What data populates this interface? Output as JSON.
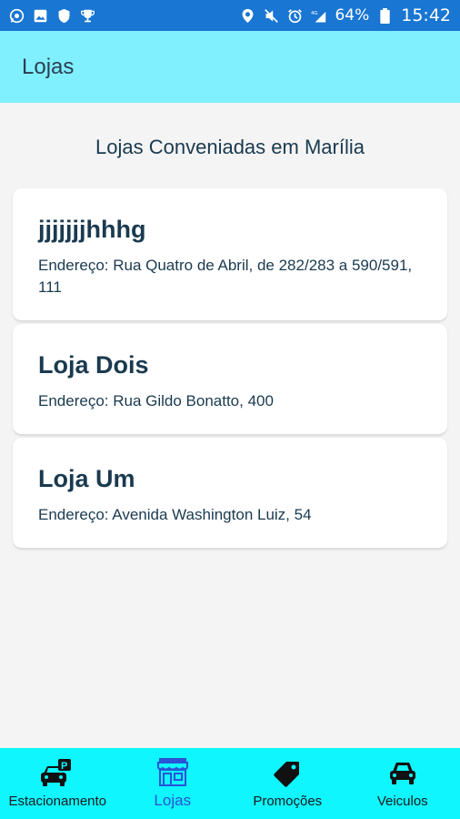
{
  "status_bar": {
    "battery": "64%",
    "time": "15:42",
    "network": "4G",
    "icons_left": [
      "whatsapp-icon",
      "image-icon",
      "shield-icon",
      "trophy-icon"
    ],
    "icons_right": [
      "location-icon",
      "mute-icon",
      "alarm-icon",
      "signal-icon",
      "battery-icon"
    ]
  },
  "app_bar": {
    "title": "Lojas"
  },
  "main": {
    "section_title": "Lojas Conveniadas em Marília",
    "stores": [
      {
        "name": "jjjjjjjhhhg",
        "address": "Endereço: Rua Quatro de Abril, de 282/283 a 590/591, 111"
      },
      {
        "name": "Loja Dois",
        "address": "Endereço: Rua Gildo Bonatto, 400"
      },
      {
        "name": "Loja Um",
        "address": "Endereço: Avenida Washington Luiz, 54"
      }
    ]
  },
  "bottom_nav": {
    "items": [
      {
        "label": "Estacionamento",
        "icon": "parking-car-icon",
        "active": false
      },
      {
        "label": "Lojas",
        "icon": "store-icon",
        "active": true
      },
      {
        "label": "Promoções",
        "icon": "tag-icon",
        "active": false
      },
      {
        "label": "Veiculos",
        "icon": "car-icon",
        "active": false
      }
    ]
  },
  "colors": {
    "status_bar": "#1976d2",
    "app_bar": "#80f0ff",
    "bottom_nav": "#0ff6ff",
    "active_nav": "#2a53d8",
    "text_dark": "#1a3a4f"
  }
}
